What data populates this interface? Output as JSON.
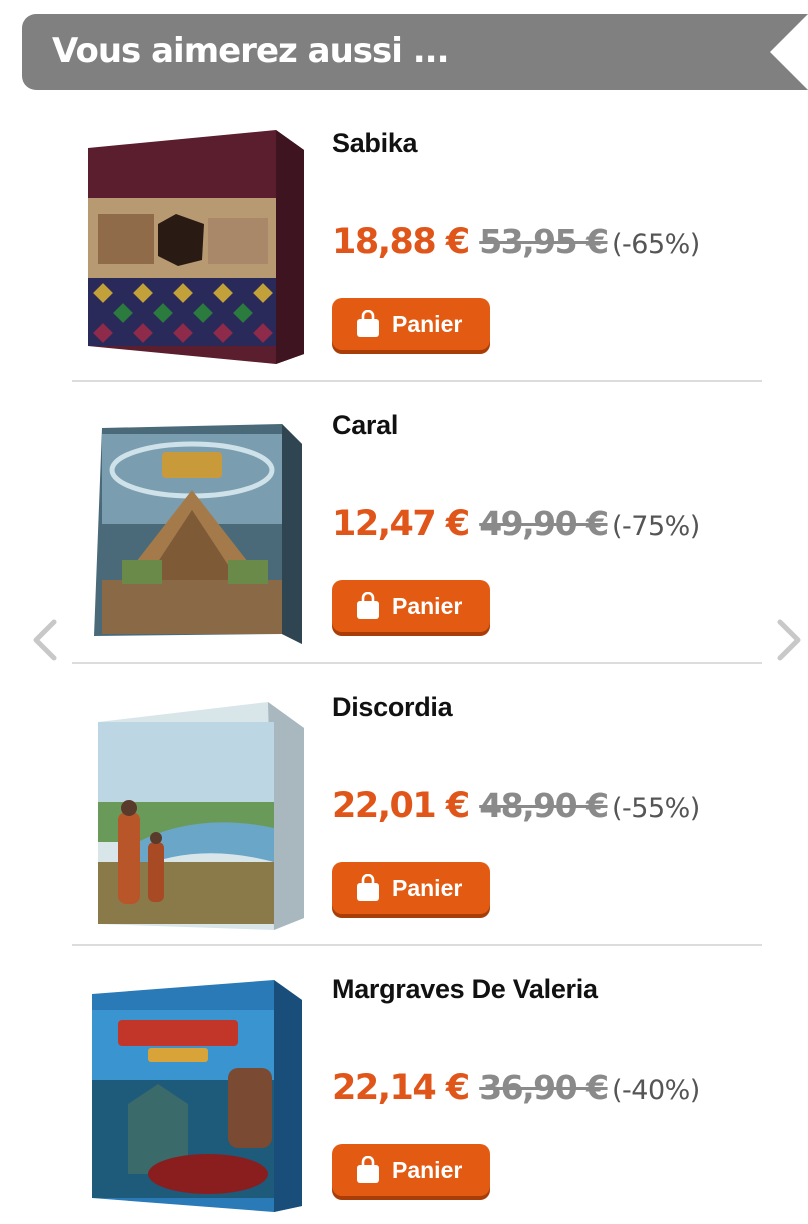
{
  "header": {
    "title": "Vous aimerez aussi ..."
  },
  "products": [
    {
      "name": "Sabika",
      "price": "18,88 €",
      "old_price": "53,95 €",
      "discount": "(-65%)",
      "cart_label": "Panier"
    },
    {
      "name": "Caral",
      "price": "12,47 €",
      "old_price": "49,90 €",
      "discount": "(-75%)",
      "cart_label": "Panier"
    },
    {
      "name": "Discordia",
      "price": "22,01 €",
      "old_price": "48,90 €",
      "discount": "(-55%)",
      "cart_label": "Panier"
    },
    {
      "name": "Margraves De Valeria",
      "price": "22,14 €",
      "old_price": "36,90 €",
      "discount": "(-40%)",
      "cart_label": "Panier"
    }
  ],
  "navigation": {
    "prev_icon": "chevron-left-icon",
    "next_icon": "chevron-right-icon"
  },
  "colors": {
    "accent": "#e35b12",
    "price": "#e0561a",
    "header_bg": "#808080",
    "old_price": "#8a8a8a"
  }
}
